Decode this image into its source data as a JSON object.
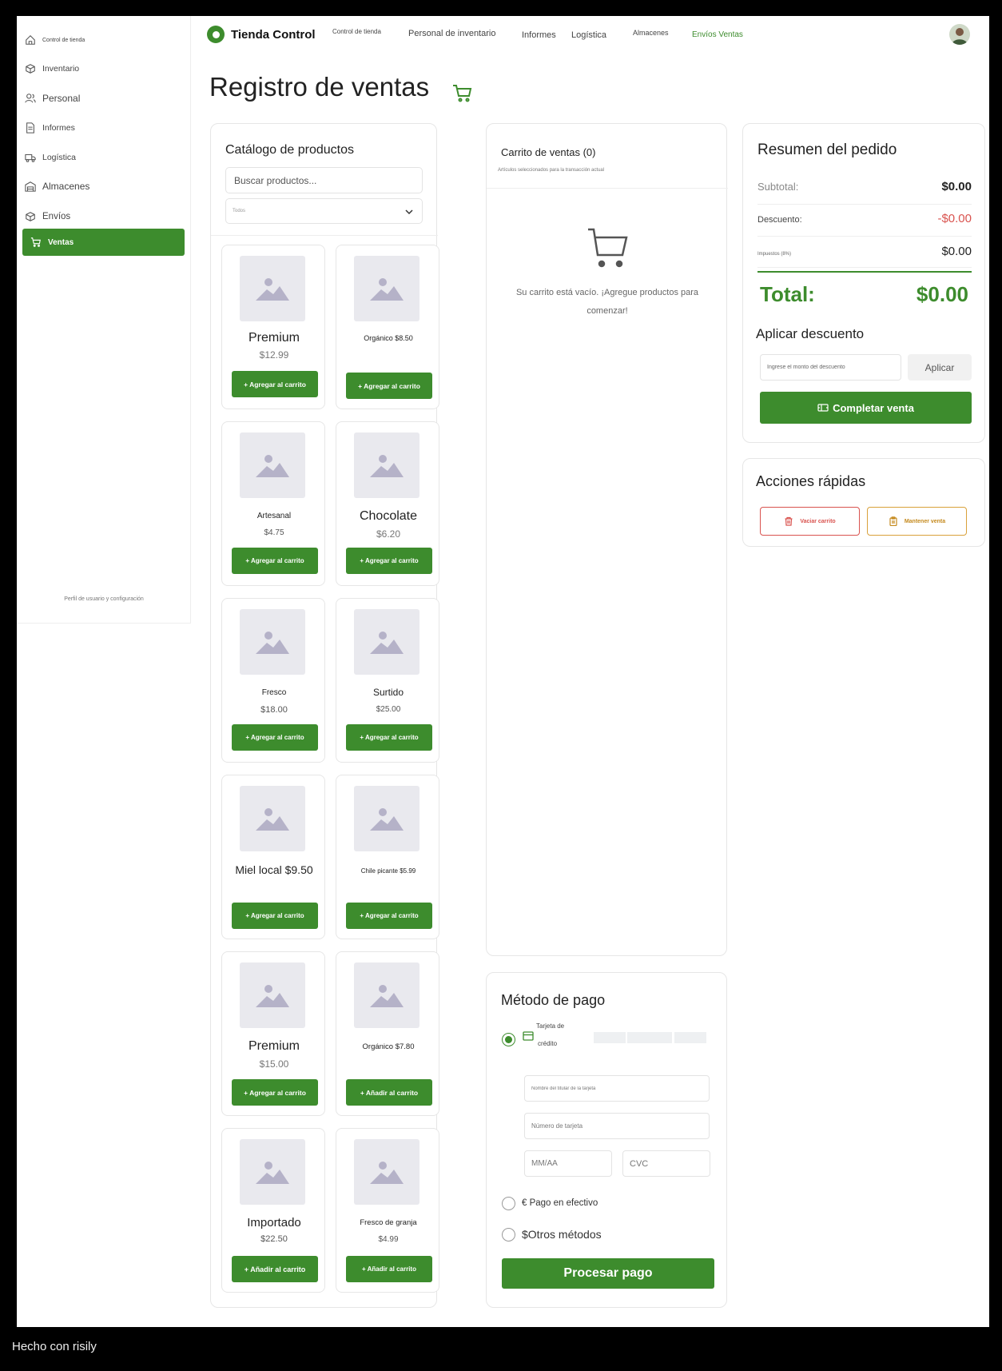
{
  "sidebar": {
    "items": [
      {
        "label": "Control de tienda",
        "icon": "home-icon"
      },
      {
        "label": "Inventario",
        "icon": "box-icon"
      },
      {
        "label": "Personal",
        "icon": "users-icon"
      },
      {
        "label": "Informes",
        "icon": "document-icon"
      },
      {
        "label": "Logística",
        "icon": "truck-icon"
      },
      {
        "label": "Almacenes",
        "icon": "warehouse-icon"
      },
      {
        "label": "Envíos",
        "icon": "package-icon"
      }
    ],
    "active": {
      "label": "Ventas",
      "icon": "cart-icon"
    },
    "footer": "Perfil de usuario y configuración"
  },
  "topbar": {
    "brand": "Tienda Control",
    "nav": [
      "Control de tienda",
      "Personal de inventario",
      "Informes",
      "Logística",
      "Almacenes",
      "Envíos Ventas"
    ],
    "active_nav": "Envíos Ventas"
  },
  "page": {
    "title": "Registro de ventas"
  },
  "catalog": {
    "title": "Catálogo de productos",
    "search_placeholder": "Buscar productos...",
    "filter_value": "Todos",
    "products": [
      {
        "name": "Premium",
        "price": "$12.99",
        "button": "+ Agregar al carrito"
      },
      {
        "name": "Orgánico $8.50",
        "price": "",
        "button": "+ Agregar al carrito"
      },
      {
        "name": "Artesanal",
        "price": "$4.75",
        "button": "+ Agregar al carrito"
      },
      {
        "name": "Chocolate",
        "price": "$6.20",
        "button": "+ Agregar al carrito"
      },
      {
        "name": "Fresco",
        "price": "$18.00",
        "button": "+ Agregar al carrito"
      },
      {
        "name": "Surtido",
        "price": "$25.00",
        "button": "+ Agregar al carrito"
      },
      {
        "name": "Miel local $9.50",
        "price": "",
        "button": "+ Agregar al carrito"
      },
      {
        "name": "Chile picante $5.99",
        "price": "",
        "button": "+ Agregar al carrito"
      },
      {
        "name": "Premium",
        "price": "$15.00",
        "button": "+ Agregar al carrito"
      },
      {
        "name": "Orgánico $7.80",
        "price": "",
        "button": "+ Añadir al carrito"
      },
      {
        "name": "Importado",
        "price": "$22.50",
        "button": "+ Añadir al carrito"
      },
      {
        "name": "Fresco de granja",
        "price": "$4.99",
        "button": "+ Añadir al carrito"
      }
    ]
  },
  "cart": {
    "title": "Carrito de ventas (0)",
    "subtitle": "Artículos seleccionados para la transacción actual",
    "empty_message": "Su carrito está vacío. ¡Agregue productos para comenzar!"
  },
  "payment": {
    "title": "Método de pago",
    "card_option_line1": "Tarjeta de",
    "card_option_line2": "crédito",
    "holder_placeholder": "Nombre del titular de la tarjeta",
    "number_placeholder": "Número de tarjeta",
    "expiry_placeholder": "MM/AA",
    "cvc_placeholder": "CVC",
    "cash_option": "€ Pago en efectivo",
    "other_option": "$Otros métodos",
    "process_button": "Procesar pago",
    "selected": "Tarjeta de crédito"
  },
  "summary": {
    "title": "Resumen del pedido",
    "subtotal_label": "Subtotal:",
    "subtotal_value": "$0.00",
    "discount_label": "Descuento:",
    "discount_value": "-$0.00",
    "tax_label": "Impuestos (8%)",
    "tax_value": "$0.00",
    "total_label": "Total:",
    "total_value": "$0.00",
    "discount_title": "Aplicar descuento",
    "discount_placeholder": "Ingrese el monto del descuento",
    "apply_button": "Aplicar",
    "complete_button": "Completar venta"
  },
  "quick_actions": {
    "title": "Acciones rápidas",
    "clear_cart": "Vaciar carrito",
    "hold_sale": "Mantener venta"
  },
  "footer": {
    "made_with": "Hecho con risily"
  },
  "colors": {
    "accent": "#3d8c2d",
    "danger": "#d9534f",
    "warning": "#d9a13a"
  }
}
